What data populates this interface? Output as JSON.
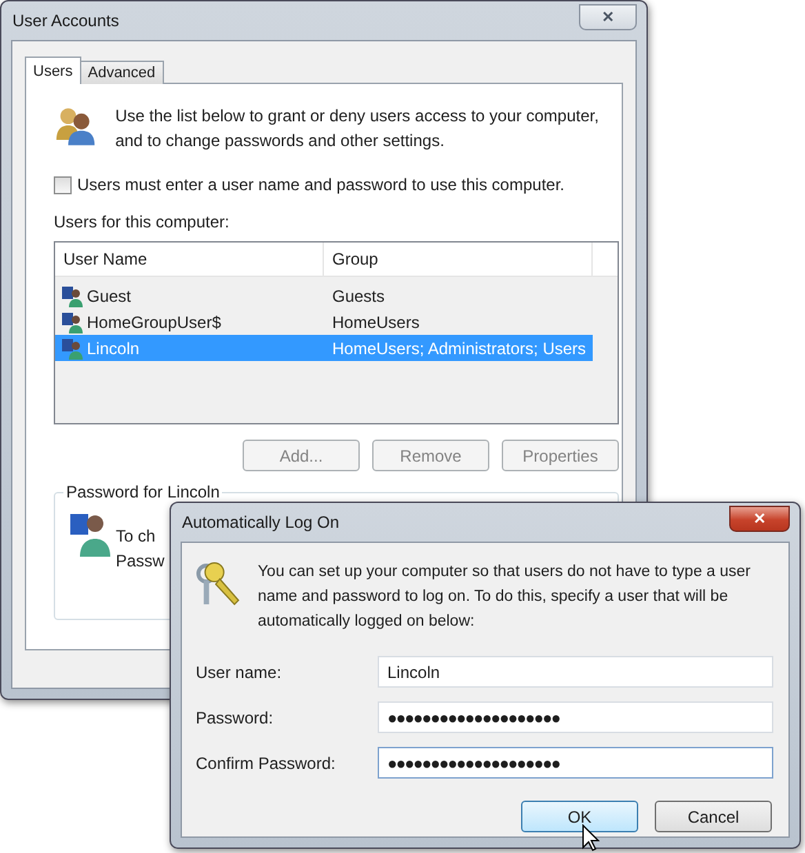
{
  "main_window": {
    "title": "User Accounts",
    "close": "✕",
    "tabs": [
      {
        "label": "Users",
        "selected": true
      },
      {
        "label": "Advanced",
        "selected": false
      }
    ],
    "intro": "Use the list below to grant or deny users access to your computer, and to change passwords and other settings.",
    "require_login": {
      "label": "Users must enter a user name and password to use this computer.",
      "checked": false
    },
    "list_label": "Users for this computer:",
    "table": {
      "columns": [
        "User Name",
        "Group"
      ],
      "rows": [
        {
          "name": "Guest",
          "group": "Guests",
          "selected": false
        },
        {
          "name": "HomeGroupUser$",
          "group": "HomeUsers",
          "selected": false
        },
        {
          "name": "Lincoln",
          "group": "HomeUsers; Administrators; Users",
          "selected": true
        }
      ]
    },
    "buttons": [
      {
        "label": "Add...",
        "disabled": true
      },
      {
        "label": "Remove",
        "disabled": true
      },
      {
        "label": "Properties",
        "disabled": true
      }
    ],
    "password_group": {
      "title": "Password for Lincoln",
      "lines": [
        "To ch",
        "Passw"
      ]
    }
  },
  "dialog": {
    "title": "Automatically Log On",
    "close": "✕",
    "message": "You can set up your computer so that users do not have to type a user name and password to log on. To do this, specify a user that will be automatically logged on below:",
    "fields": [
      {
        "label": "User name:",
        "value": "Lincoln",
        "focused": false
      },
      {
        "label": "Password:",
        "value": "●●●●●●●●●●●●●●●●●●●●",
        "focused": false
      },
      {
        "label": "Confirm Password:",
        "value": "●●●●●●●●●●●●●●●●●●●●",
        "focused": true
      }
    ],
    "buttons": [
      {
        "label": "OK",
        "default": true
      },
      {
        "label": "Cancel",
        "default": false
      }
    ]
  }
}
